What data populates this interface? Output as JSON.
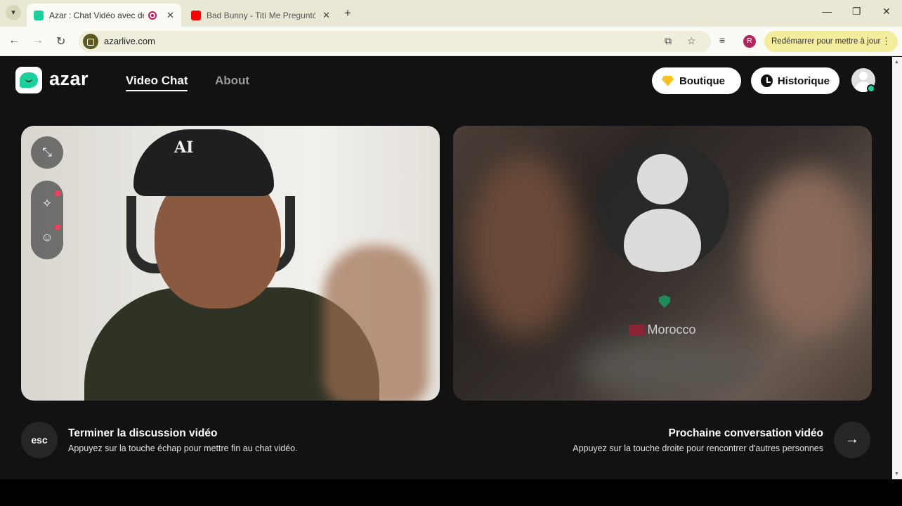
{
  "browser": {
    "tabs": [
      {
        "title": "Azar : Chat Vidéo avec de n",
        "active": true,
        "favicon_color": "#1bd19b"
      },
      {
        "title": "Bad Bunny - Tití Me Preguntó (",
        "active": false,
        "favicon_color": "#ff0000"
      }
    ],
    "new_tab_icon": "+",
    "window_controls": {
      "minimize": "—",
      "maximize": "❐",
      "close": "✕"
    },
    "nav": {
      "back": "←",
      "forward": "→",
      "reload": "↻"
    },
    "url": "azarlive.com",
    "profile_initial": "R",
    "update_button": "Redémarrer pour mettre à jour"
  },
  "site": {
    "logo_text": "azar",
    "nav": [
      {
        "label": "Video Chat",
        "active": true
      },
      {
        "label": "About",
        "active": false
      }
    ],
    "boutique_label": "Boutique",
    "historique_label": "Historique",
    "accent_color": "#1bd19b"
  },
  "local_video": {
    "cap_text": "AI",
    "controls": [
      "minimize-icon",
      "magic-wand-icon",
      "face-sticker-icon"
    ]
  },
  "remote_video": {
    "country": "Morocco"
  },
  "actions": {
    "end": {
      "key_label": "esc",
      "title": "Terminer la discussion vidéo",
      "subtitle": "Appuyez sur la touche échap pour mettre fin au chat vidéo."
    },
    "next": {
      "title": "Prochaine conversation vidéo",
      "subtitle": "Appuyez sur la touche droite pour rencontrer d'autres personnes"
    }
  }
}
